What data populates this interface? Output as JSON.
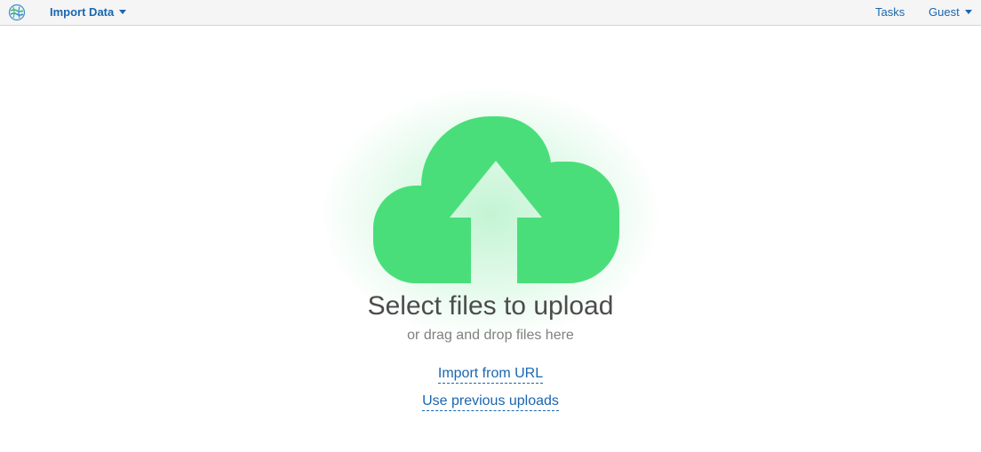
{
  "navbar": {
    "logo_icon": "globe-logo-icon",
    "import_menu_label": "Import Data",
    "tasks_label": "Tasks",
    "user_menu_label": "Guest",
    "link_color": "#1a66b0"
  },
  "upload": {
    "icon": "cloud-upload-icon",
    "icon_color": "#4ade7a",
    "title": "Select files to upload",
    "subtitle": "or drag and drop files here",
    "import_url_label": "Import from URL",
    "previous_uploads_label": "Use previous uploads"
  }
}
